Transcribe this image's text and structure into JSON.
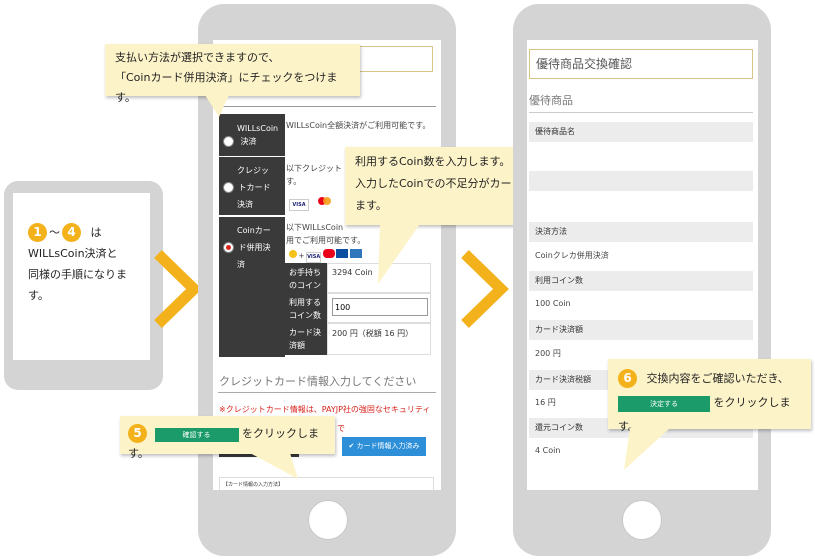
{
  "left_phone": {
    "step_from": "1",
    "step_sep": "～",
    "step_to": "4",
    "text_line1": "は",
    "text_line2": "WILLsCoin決済と",
    "text_line3": "同様の手順になりま",
    "text_line4": "す。"
  },
  "middle_phone": {
    "callout_top_line1": "支払い方法が選択できますので、",
    "callout_top_line2": "「Coinカード併用決済」にチェックをつけます。",
    "payment_options": [
      {
        "label_line1": "WILLsCoin",
        "label_line2": "決済",
        "desc": "WILLsCoin全額決済がご利用可能です。"
      },
      {
        "label_line1": "クレジッ",
        "label_line2": "トカード",
        "label_line3": "決済",
        "desc_line1": "以下クレジット",
        "desc_line2": "す。"
      },
      {
        "label_line1": "Coinカー",
        "label_line2": "ド併用決",
        "label_line3": "済",
        "desc_line1": "以下WILLsCoin",
        "desc_line2": "用でご利用可能です。"
      }
    ],
    "card_brands": [
      "VISA",
      "MC",
      "JCB",
      "AMEX",
      "Diners"
    ],
    "coin_rows": [
      {
        "label_line1": "お手持ち",
        "label_line2": "のコイン",
        "value": "3294 Coin"
      },
      {
        "label_line1": "利用する",
        "label_line2": "コイン数",
        "input_value": "100"
      },
      {
        "label_line1": "カード決",
        "label_line2": "済額",
        "value": "200 円（税額 16 円）"
      }
    ],
    "callout_mid_line1": "利用するCoin数を入力します。",
    "callout_mid_line2": "入力したCoinでの不足分がカードで支払われ",
    "callout_mid_line3": "ます。",
    "credit_heading": "クレジットカード情報入力してください",
    "red_notice": "※クレジットカード情報は、PAYJP社の強固なセキュリティ",
    "red_notice2": "で",
    "card_done_button": "✔ カード情報入力済み",
    "card_method_label": "【カード情報の入力方法】",
    "step5_num": "5",
    "step5_button": "確認する",
    "step5_text": "をクリックします。"
  },
  "right_phone": {
    "title": "優待商品交換確認",
    "section": "優待商品",
    "fields": [
      {
        "label": "優待商品名",
        "value": ""
      },
      {
        "label": "",
        "value": ""
      },
      {
        "label": "決済方法",
        "value": "Coinクレカ併用決済"
      },
      {
        "label": "利用コイン数",
        "value": "100 Coin"
      },
      {
        "label": "カード決済額",
        "value": "200 円"
      },
      {
        "label": "カード決済税額",
        "value": "16 円"
      },
      {
        "label": "還元コイン数",
        "value": "4 Coin"
      }
    ],
    "step6_num": "6",
    "step6_text": "交換内容をご確認いただき、",
    "step6_button": "決定する",
    "step6_text2": "をクリックします。"
  },
  "colors": {
    "accent": "#f3b21b",
    "bubble": "#fdf3c9",
    "green_button": "#1b9a6a",
    "blue_button": "#2d8fd8",
    "dark_cell": "#3a3a3a",
    "title_border": "#d7c58a"
  },
  "icons": [
    "chevron-right-icon",
    "radio-icon",
    "card-brand-icon"
  ]
}
